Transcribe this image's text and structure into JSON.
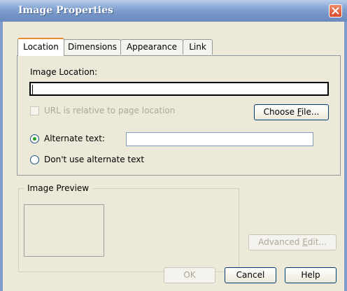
{
  "window": {
    "title": "Image Properties",
    "close_icon": "close-icon"
  },
  "tabs": [
    {
      "label": "Location",
      "active": true
    },
    {
      "label": "Dimensions",
      "active": false
    },
    {
      "label": "Appearance",
      "active": false
    },
    {
      "label": "Link",
      "active": false
    }
  ],
  "location": {
    "image_location_label": "Image Location:",
    "image_location_value": "",
    "relative_url_label": "URL is relative to page location",
    "relative_url_checked": false,
    "choose_file_label": "Choose File...",
    "alternate_text_label": "Alternate text:",
    "alternate_text_value": "",
    "alternate_text_selected": true,
    "no_alt_text_label": "Don't use alternate text",
    "no_alt_text_selected": false
  },
  "preview": {
    "title": "Image Preview"
  },
  "buttons": {
    "advanced_edit": "Advanced Edit...",
    "ok": "OK",
    "cancel": "Cancel",
    "help": "Help"
  },
  "colors": {
    "tab_active_accent": "#e68b2c",
    "radio_dot": "#21a121",
    "title_bar": "#7797c8"
  }
}
